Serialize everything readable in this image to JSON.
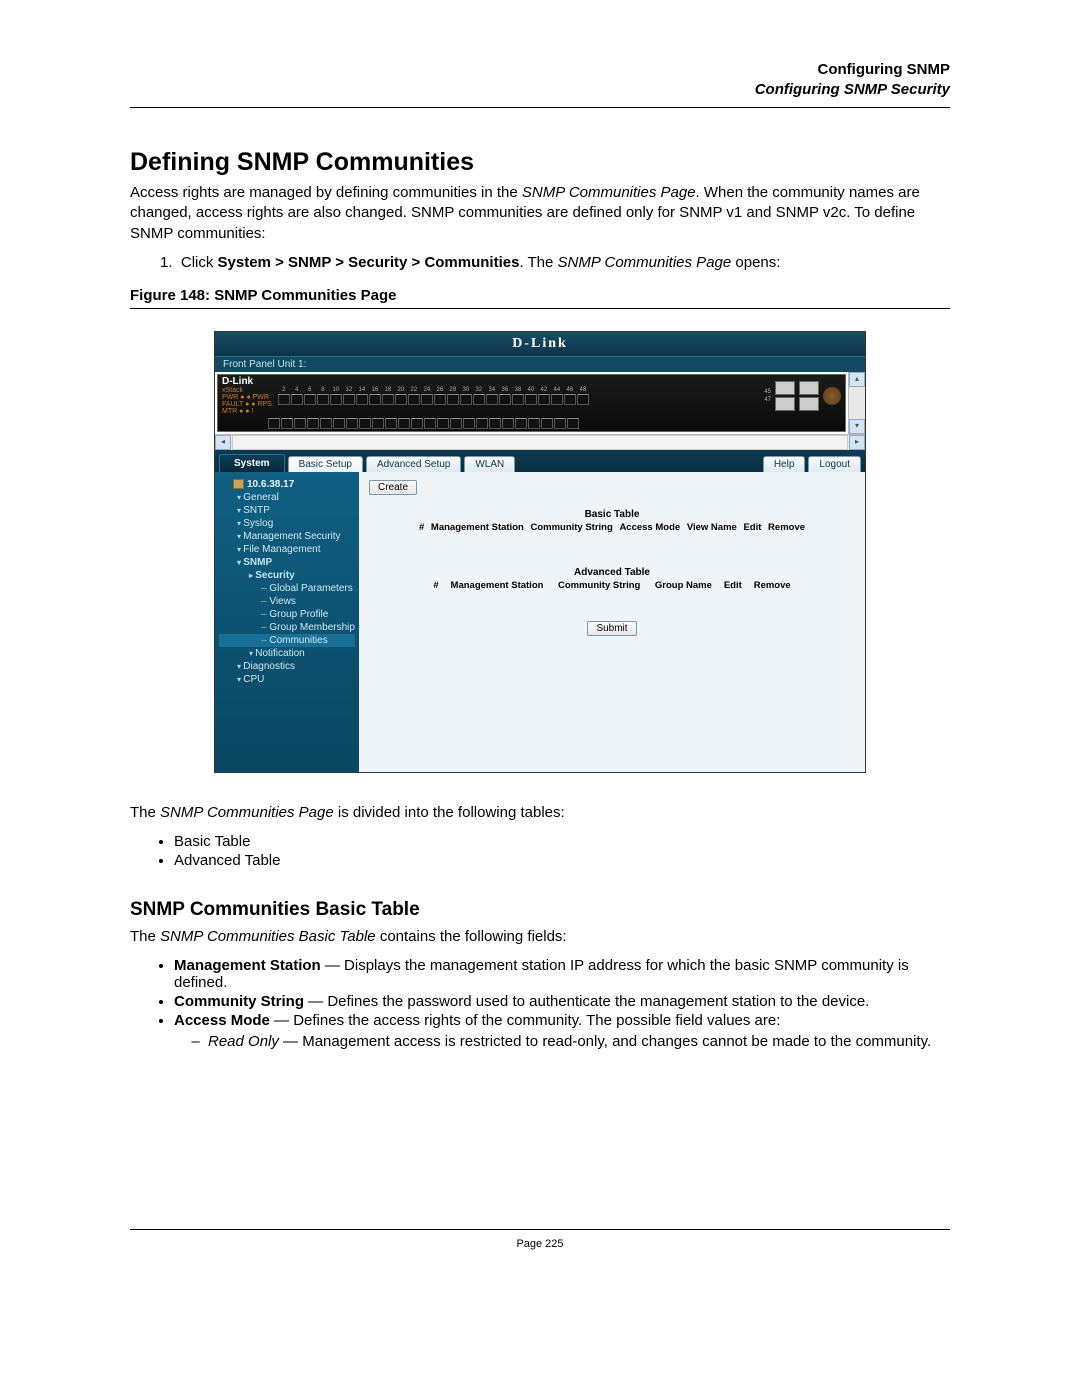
{
  "header": {
    "line1": "Configuring SNMP",
    "line2": "Configuring SNMP Security"
  },
  "title": "Defining SNMP Communities",
  "intro_parts": {
    "a": "Access rights are managed by defining communities in the ",
    "i": "SNMP Communities Page",
    "b": ". When the community names are changed, access rights are also changed. SNMP communities are defined only for SNMP v1 and SNMP v2c. To define SNMP communities:"
  },
  "step": {
    "num": "1.",
    "a": "Click ",
    "path": "System > SNMP > Security > Communities",
    "b": ". The ",
    "i": "SNMP Communities Page",
    "c": " opens:"
  },
  "figcap": "Figure 148: SNMP Communities Page",
  "after_fig": {
    "a": "The ",
    "i": "SNMP Communities Page",
    "b": " is divided into the following tables:"
  },
  "bullets1": [
    "Basic Table",
    "Advanced Table"
  ],
  "h2": "SNMP Communities Basic Table",
  "h2intro": {
    "a": "The ",
    "i": "SNMP Communities Basic Table",
    "b": " contains the following fields:"
  },
  "fields": [
    {
      "name": "Management Station",
      "desc": " — Displays the management station IP address for which the basic SNMP community is defined."
    },
    {
      "name": "Community String",
      "desc": " — Defines the password used to authenticate the management station to the device."
    },
    {
      "name": "Access Mode",
      "desc": " — Defines the access rights of the community. The possible field values are:",
      "sub": [
        {
          "name": "Read Only",
          "desc": " — Management access is restricted to read-only, and changes cannot be made to the community."
        }
      ]
    }
  ],
  "footer_page": "Page 225",
  "ui": {
    "brand": "D-Link",
    "front_panel": "Front Panel Unit 1:",
    "device_brand": "D-Link",
    "device_lines": [
      "xStack",
      "PWR ● ● PWR",
      "FAULT ● ● RPS",
      "MTR ● ● !"
    ],
    "port_numbers_top": [
      "2",
      "4",
      "6",
      "8",
      "10",
      "12",
      "14",
      "16",
      "18",
      "20",
      "22",
      "24",
      "26",
      "28",
      "30",
      "32",
      "34",
      "36",
      "38",
      "40",
      "42",
      "44",
      "46",
      "48"
    ],
    "side_numbers": [
      "45",
      "47"
    ],
    "tabs": {
      "system": "System",
      "basic": "Basic Setup",
      "adv": "Advanced Setup",
      "wlan": "WLAN",
      "help": "Help",
      "logout": "Logout"
    },
    "tree": {
      "ip": "10.6.38.17",
      "items_top": [
        "General",
        "SNTP",
        "Syslog",
        "Management Security",
        "File Management"
      ],
      "snmp": "SNMP",
      "security": "Security",
      "sec_children": [
        "Global Parameters",
        "Views",
        "Group Profile",
        "Group Membership",
        "Communities"
      ],
      "notification": "Notification",
      "items_bottom": [
        "Diagnostics",
        "CPU"
      ]
    },
    "buttons": {
      "create": "Create",
      "submit": "Submit"
    },
    "basic_table": {
      "title": "Basic Table",
      "cols": [
        "#",
        "Management Station",
        "Community String",
        "Access Mode",
        "View Name",
        "Edit",
        "Remove"
      ]
    },
    "adv_table": {
      "title": "Advanced Table",
      "cols": [
        "#",
        "Management Station",
        "Community String",
        "Group Name",
        "Edit",
        "Remove"
      ]
    }
  }
}
